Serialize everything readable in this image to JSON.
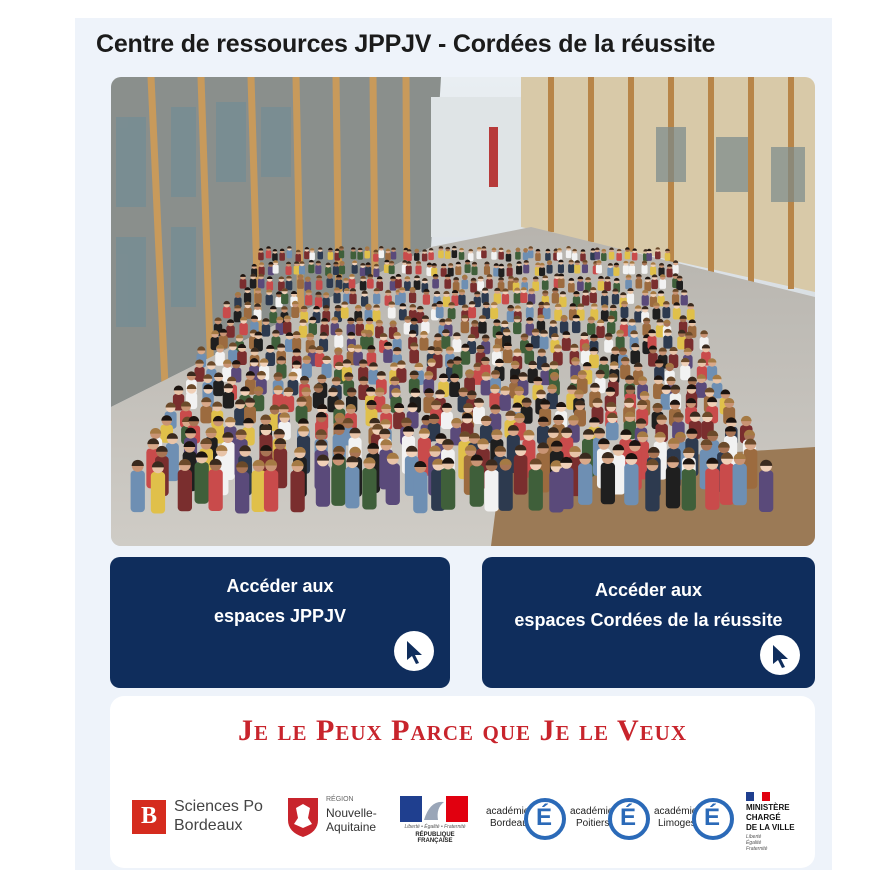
{
  "header": {
    "title": "Centre de ressources JPPJV - Cordées de la réussite"
  },
  "buttons": [
    {
      "line1": "Accéder aux",
      "line2": "espaces JPPJV",
      "icon": "pointer-click-icon"
    },
    {
      "line1": "Accéder aux",
      "line2": "espaces Cordées de la réussite",
      "icon": "pointer-click-icon"
    }
  ],
  "footer": {
    "motto": "Je le Peux Parce que Je le Veux",
    "logos": {
      "sciencespo": {
        "name": "Sciences Po",
        "city": "Bordeaux"
      },
      "region": {
        "small": "RÉGION",
        "line1": "Nouvelle-",
        "line2": "Aquitaine"
      },
      "republique": {
        "motto": "Liberté • Égalité • Fraternité",
        "name": "RÉPUBLIQUE FRANÇAISE"
      },
      "academies": [
        {
          "prefix": "académie",
          "city": "Bordeaux",
          "letter": "É"
        },
        {
          "prefix": "académie",
          "city": "Poitiers",
          "letter": "É"
        },
        {
          "prefix": "académie",
          "city": "Limoges",
          "letter": "É"
        }
      ],
      "ministere": {
        "line1": "MINISTÈRE",
        "line2": "CHARGÉ",
        "line3": "DE LA VILLE",
        "motto1": "Liberté",
        "motto2": "Égalité",
        "motto3": "Fraternité"
      }
    }
  },
  "colors": {
    "navy": "#0f2d5c",
    "red": "#c8242c",
    "panel": "#eef3fa"
  }
}
